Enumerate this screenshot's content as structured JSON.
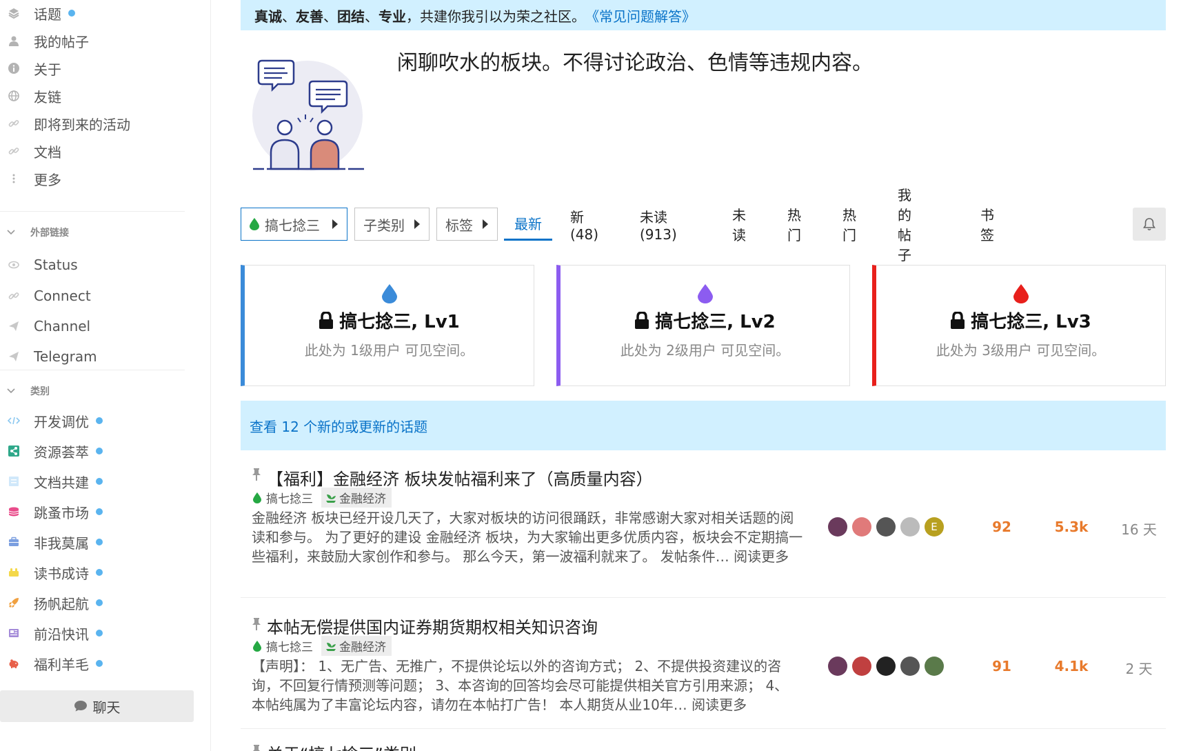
{
  "sidebar": {
    "top_items": [
      {
        "label": "话题",
        "icon": "layers-icon",
        "dot": true
      },
      {
        "label": "我的帖子",
        "icon": "user-icon",
        "dot": false
      },
      {
        "label": "关于",
        "icon": "info-icon",
        "dot": false
      },
      {
        "label": "友链",
        "icon": "globe-icon",
        "dot": false
      },
      {
        "label": "即将到来的活动",
        "icon": "link-icon",
        "dot": false
      },
      {
        "label": "文档",
        "icon": "link-icon",
        "dot": false
      },
      {
        "label": "更多",
        "icon": "more-vertical-icon",
        "dot": false
      }
    ],
    "external_header": "外部链接",
    "external_items": [
      {
        "label": "Status",
        "icon": "eye-icon"
      },
      {
        "label": "Connect",
        "icon": "link-icon"
      },
      {
        "label": "Channel",
        "icon": "send-icon"
      },
      {
        "label": "Telegram",
        "icon": "send-icon"
      }
    ],
    "category_header": "类别",
    "categories": [
      {
        "label": "开发调优",
        "color": "#5ab4ef"
      },
      {
        "label": "资源荟萃",
        "color": "#2fa88a"
      },
      {
        "label": "文档共建",
        "color": "#8ec6f0"
      },
      {
        "label": "跳蚤市场",
        "color": "#e94b8a"
      },
      {
        "label": "非我莫属",
        "color": "#7b9fe0"
      },
      {
        "label": "读书成诗",
        "color": "#f4d84a"
      },
      {
        "label": "扬帆起航",
        "color": "#f0a040"
      },
      {
        "label": "前沿快讯",
        "color": "#a38ad8"
      },
      {
        "label": "福利羊毛",
        "color": "#e8604a"
      }
    ],
    "chat_label": "聊天"
  },
  "banner": {
    "bold_words": [
      "真诚",
      "友善",
      "团结",
      "专业"
    ],
    "sep": "、",
    "text": "，共建你我引以为荣之社区。",
    "faq_link": "《常见问题解答》"
  },
  "category_description": "闲聊吹水的板块。不得讨论政治、色情等违规内容。",
  "nav": {
    "category_dropdown": "搞七捻三",
    "subcategory_dropdown": "子类别",
    "tags_dropdown": "标签",
    "tabs": [
      "最新",
      "新 (48)",
      "未读 (913)",
      "未读",
      "热门",
      "热门",
      "我的帖子",
      "书签"
    ],
    "active_tab": "最新"
  },
  "level_cards": [
    {
      "title": "搞七捻三, Lv1",
      "desc": "此处为 1级用户 可见空间。",
      "color": "#3b8bd9"
    },
    {
      "title": "搞七捻三, Lv2",
      "desc": "此处为 2级用户 可见空间。",
      "color": "#8c5cf0"
    },
    {
      "title": "搞七捻三, Lv3",
      "desc": "此处为 3级用户 可见空间。",
      "color": "#e8201c"
    }
  ],
  "new_topics_bar": "查看 12 个新的或更新的话题",
  "topics": [
    {
      "title": "【福利】金融经济 板块发帖福利来了（高质量内容）",
      "category": "搞七捻三",
      "tag": "金融经济",
      "excerpt": "金融经济 板块已经开设几天了，大家对板块的访问很踊跃，非常感谢大家对相关话题的阅读和参与。 为了更好的建设 金融经济 板块，为大家输出更多优质内容，板块会不定期搞一些福利，来鼓励大家创作和参与。 那么今天，第一波福利就来了。 发帖条件… 阅读更多",
      "avatars": [
        "#6a3a5c",
        "#e07a7a",
        "#555555",
        "#bbbbbb",
        "#b8a020"
      ],
      "avatar_letter": "E",
      "replies": "92",
      "views": "5.3k",
      "age": "16 天"
    },
    {
      "title": "本帖无偿提供国内证券期货期权相关知识咨询",
      "category": "搞七捻三",
      "tag": "金融经济",
      "excerpt": "【声明】： 1、无广告、无推广，不提供论坛以外的咨询方式； 2、不提供投资建议的咨询，不回复行情预测等问题； 3、本咨询的回答均会尽可能提供相关官方引用来源； 4、本帖纯属为了丰富论坛内容，请勿在本帖打广告！ 本人期货从业10年… 阅读更多",
      "avatars": [
        "#6a3a5c",
        "#c04040",
        "#222222",
        "#555555",
        "#5a7a4a"
      ],
      "avatar_letter": "",
      "replies": "91",
      "views": "4.1k",
      "age": "2 天"
    },
    {
      "title": "关于“搞七捻三”类别"
    }
  ]
}
